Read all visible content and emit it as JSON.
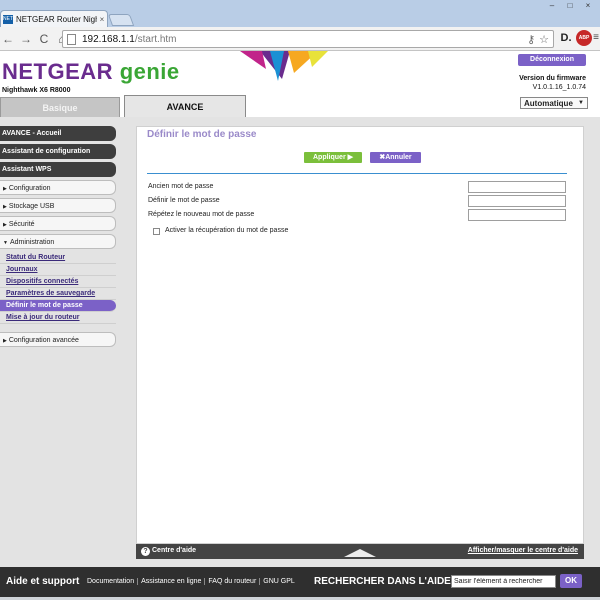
{
  "browser": {
    "tab_title": "NETGEAR Router Nighthæ",
    "tab_close": "×",
    "favicon_text": "NETGEAR",
    "url_host": "192.168.1.1",
    "url_path": "/start.htm",
    "nav_back": "←",
    "nav_forward": "→",
    "nav_reload": "C",
    "nav_home": "⌂",
    "ext_d": "D.",
    "ext_abp": "ABP",
    "ext_menu": "≡",
    "win_min": "–",
    "win_max": "□",
    "win_close": "×"
  },
  "header": {
    "logo_main": "NETGEAR",
    "logo_genie": "genie",
    "model": "Nighthawk X6 R8000",
    "logout": "Déconnexion",
    "firmware_label": "Version du firmware",
    "firmware_version": "V1.0.1.16_1.0.74",
    "brand_colors": [
      "#6a2c8e",
      "#3aa635",
      "#7b61c7"
    ]
  },
  "tabs": {
    "basic": "Basique",
    "advanced": "AVANCE",
    "mode": "Automatique"
  },
  "sidebar": {
    "dark_items": [
      "AVANCE - Accueil",
      "Assistant de configuration",
      "Assistant WPS"
    ],
    "sections": [
      "Configuration",
      "Stockage USB",
      "Sécurité",
      "Administration"
    ],
    "admin_items": [
      "Statut du Routeur",
      "Journaux",
      "Dispositifs connectés",
      "Paramètres de sauvegarde",
      "Définir le mot de passe",
      "Mise à jour du routeur"
    ],
    "advanced_config": "Configuration avancée"
  },
  "content": {
    "title": "Définir le mot de passe",
    "apply": "Appliquer ▶",
    "cancel": "✖Annuler",
    "old_password": "Ancien mot de passe",
    "new_password": "Définir le mot de passe",
    "repeat_password": "Répétez le nouveau mot de passe",
    "recovery": "Activer la récupération du mot de passe"
  },
  "helpbar": {
    "q": "?",
    "label": "Centre d'aide",
    "toggle": "Afficher/masquer le centre d'aide"
  },
  "footer": {
    "title": "Aide et support",
    "links": [
      "Documentation",
      "Assistance en ligne",
      "FAQ du routeur",
      "GNU GPL"
    ],
    "search_label": "RECHERCHER DANS L'AIDE",
    "search_value": "Saisir l'élément à rechercher",
    "ok": "OK"
  }
}
